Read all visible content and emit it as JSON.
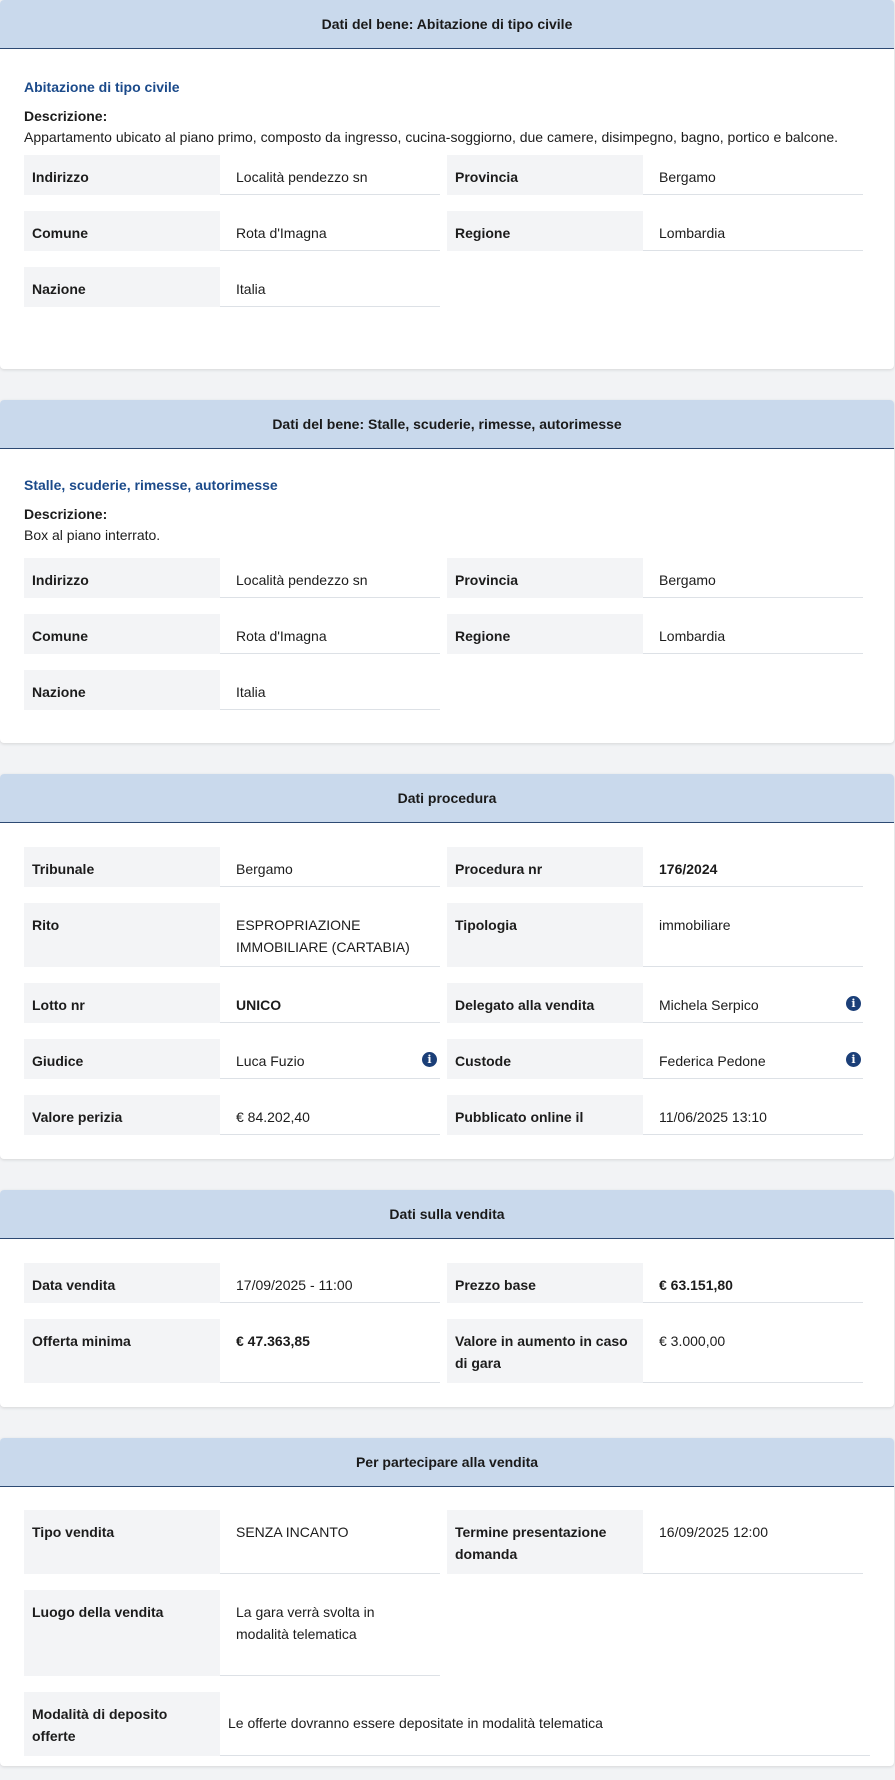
{
  "bene1": {
    "header": "Dati del bene: Abitazione di tipo civile",
    "subtitle": "Abitazione di tipo civile",
    "desc_label": "Descrizione:",
    "desc_text": "Appartamento ubicato al piano primo, composto da ingresso, cucina-soggiorno, due camere, disimpegno, bagno, portico e balcone.",
    "indirizzo_label": "Indirizzo",
    "indirizzo_value": "Località pendezzo sn",
    "provincia_label": "Provincia",
    "provincia_value": "Bergamo",
    "comune_label": "Comune",
    "comune_value": "Rota d'Imagna",
    "regione_label": "Regione",
    "regione_value": "Lombardia",
    "nazione_label": "Nazione",
    "nazione_value": "Italia"
  },
  "bene2": {
    "header": "Dati del bene: Stalle, scuderie, rimesse, autorimesse",
    "subtitle": "Stalle, scuderie, rimesse, autorimesse",
    "desc_label": "Descrizione:",
    "desc_text": "Box al piano interrato.",
    "indirizzo_label": "Indirizzo",
    "indirizzo_value": "Località pendezzo sn",
    "provincia_label": "Provincia",
    "provincia_value": "Bergamo",
    "comune_label": "Comune",
    "comune_value": "Rota d'Imagna",
    "regione_label": "Regione",
    "regione_value": "Lombardia",
    "nazione_label": "Nazione",
    "nazione_value": "Italia"
  },
  "procedura": {
    "header": "Dati procedura",
    "tribunale_label": "Tribunale",
    "tribunale_value": "Bergamo",
    "procedura_label": "Procedura nr",
    "procedura_value": "176/2024",
    "rito_label": "Rito",
    "rito_value": "ESPROPRIAZIONE IMMOBILIARE (CARTABIA)",
    "tipologia_label": "Tipologia",
    "tipologia_value": "immobiliare",
    "lotto_label": "Lotto nr",
    "lotto_value": "UNICO",
    "delegato_label": "Delegato alla vendita",
    "delegato_value": "Michela Serpico",
    "giudice_label": "Giudice",
    "giudice_value": "Luca Fuzio",
    "custode_label": "Custode",
    "custode_value": "Federica Pedone",
    "valore_label": "Valore perizia",
    "valore_value": "€ 84.202,40",
    "pubblicato_label": "Pubblicato online il",
    "pubblicato_value": "11/06/2025 13:10",
    "info_glyph": "i"
  },
  "vendita": {
    "header": "Dati sulla vendita",
    "data_label": "Data vendita",
    "data_value": "17/09/2025 - 11:00",
    "prezzo_label": "Prezzo base",
    "prezzo_value": "€ 63.151,80",
    "offerta_label": "Offerta minima",
    "offerta_value": "€ 47.363,85",
    "aumento_label": "Valore in aumento in caso di gara",
    "aumento_value": "€ 3.000,00"
  },
  "partecipare": {
    "header": "Per partecipare alla vendita",
    "tipo_label": "Tipo vendita",
    "tipo_value": "SENZA INCANTO",
    "termine_label": "Termine presentazione domanda",
    "termine_value": "16/09/2025 12:00",
    "luogo_label": "Luogo della vendita",
    "luogo_value": "La gara verrà svolta in modalità telematica",
    "deposito_label": "Modalità di deposito offerte",
    "deposito_value": "Le offerte dovranno essere depositate in modalità telematica"
  }
}
